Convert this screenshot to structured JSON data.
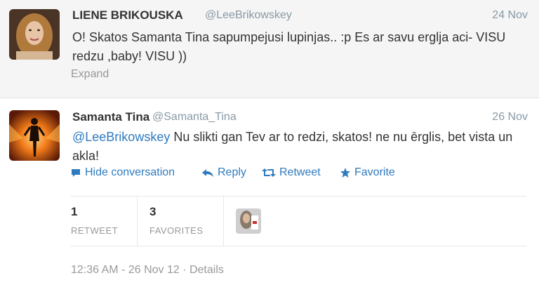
{
  "tweets": [
    {
      "name": "LIENE BRIKOUSKA",
      "handle": "@LeeBrikowskey",
      "date": "24 Nov",
      "text": "O! Skatos Samanta Tina sapumpejusi lupinjas.. :p Es ar savu erglja aci- VISU redzu ,baby! VISU ))",
      "expand_label": "Expand",
      "avatar_icon": "profile-photo-blonde-woman"
    },
    {
      "name": "Samanta Tina",
      "handle": "@Samanta_Tina",
      "date": "26 Nov",
      "mention": "@LeeBrikowskey",
      "text": " Nu slikti gan Tev ar to redzi, skatos! ne nu ērglis, bet vista un akla!",
      "avatar_icon": "profile-photo-stage-performer",
      "actions": {
        "hide": "Hide conversation",
        "reply": "Reply",
        "retweet": "Retweet",
        "favorite": "Favorite"
      },
      "stats": {
        "retweets_count": "1",
        "retweets_label": "RETWEET",
        "favorites_count": "3",
        "favorites_label": "FAVORITES"
      },
      "meta": "12:36 AM - 26 Nov 12 · Details"
    }
  ],
  "colors": {
    "link": "#2f7bbf",
    "muted": "#999999",
    "background_expanded": "#f5f5f5"
  }
}
